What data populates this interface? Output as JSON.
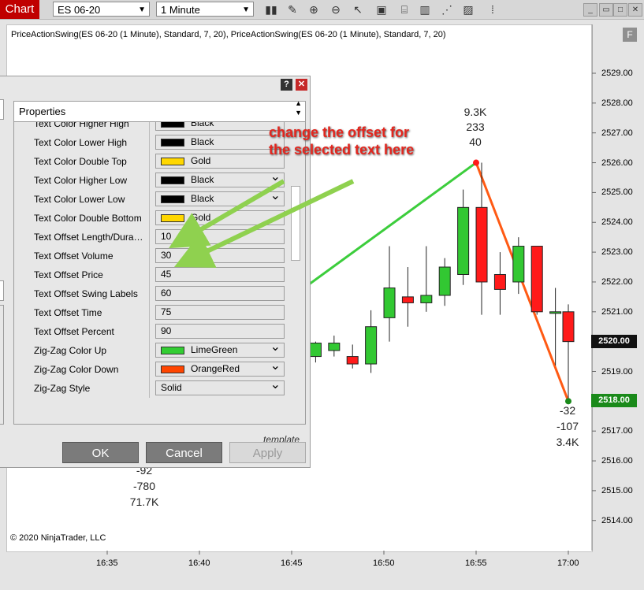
{
  "toolbar": {
    "tab_label": "Chart",
    "instrument": "ES 06-20",
    "interval": "1 Minute",
    "icons": [
      "bar-type-icon",
      "draw-pencil-icon",
      "zoom-in-icon",
      "zoom-out-icon",
      "pointer-icon",
      "data-box-icon",
      "indicators-icon",
      "strategies-icon",
      "properties-icon",
      "more-icon"
    ]
  },
  "chart": {
    "caption": "PriceActionSwing(ES 06-20 (1 Minute), Standard, 7, 20), PriceActionSwing(ES 06-20 (1 Minute), Standard, 7, 20)",
    "copyright": "© 2020 NinjaTrader, LLC",
    "f_label": "F",
    "current_price_tag": "2520.00",
    "last_swing_tag": "2518.00",
    "swing_high_label": [
      "9.3K",
      "233",
      "40"
    ],
    "swing_low_label": [
      "-32",
      "-107",
      "3.4K"
    ],
    "swing_left_label": [
      "-92",
      "-780",
      "71.7K"
    ],
    "annotation": "change the offset for the selected text here",
    "colors": {
      "up": "#32c832",
      "down": "#ff1a1a",
      "zigzag_up": "#3ccd3c",
      "zigzag_down": "#ff5a14"
    }
  },
  "chart_data": {
    "type": "candlestick",
    "y_ticks": [
      "2529.00",
      "2528.00",
      "2527.00",
      "2526.00",
      "2525.00",
      "2524.00",
      "2523.00",
      "2522.00",
      "2521.00",
      "2520.00",
      "2519.00",
      "2518.00",
      "2517.00",
      "2516.00",
      "2515.00",
      "2514.00"
    ],
    "x_ticks": [
      "16:35",
      "16:40",
      "16:45",
      "16:50",
      "16:55",
      "17:00"
    ],
    "ylim": [
      2513.6,
      2529.4
    ],
    "candles": [
      {
        "t": 46.3,
        "o": 2519.5,
        "h": 2520.0,
        "l": 2519.3,
        "c": 2519.95
      },
      {
        "t": 47.3,
        "o": 2519.7,
        "h": 2520.2,
        "l": 2519.5,
        "c": 2519.95
      },
      {
        "t": 48.3,
        "o": 2519.5,
        "h": 2519.9,
        "l": 2519.1,
        "c": 2519.25
      },
      {
        "t": 49.3,
        "o": 2519.25,
        "h": 2521.05,
        "l": 2518.95,
        "c": 2520.5
      },
      {
        "t": 50.3,
        "o": 2520.8,
        "h": 2523.2,
        "l": 2520.0,
        "c": 2521.8
      },
      {
        "t": 51.3,
        "o": 2521.5,
        "h": 2522.5,
        "l": 2520.5,
        "c": 2521.3
      },
      {
        "t": 52.3,
        "o": 2521.3,
        "h": 2523.2,
        "l": 2521.0,
        "c": 2521.55
      },
      {
        "t": 53.3,
        "o": 2521.55,
        "h": 2522.8,
        "l": 2521.2,
        "c": 2522.5
      },
      {
        "t": 54.3,
        "o": 2522.25,
        "h": 2525.1,
        "l": 2521.9,
        "c": 2524.5
      },
      {
        "t": 55.3,
        "o": 2524.5,
        "h": 2526.0,
        "l": 2520.9,
        "c": 2522.0
      },
      {
        "t": 56.3,
        "o": 2522.25,
        "h": 2523.0,
        "l": 2520.9,
        "c": 2521.75
      },
      {
        "t": 57.3,
        "o": 2522.0,
        "h": 2523.5,
        "l": 2521.6,
        "c": 2523.2
      },
      {
        "t": 58.3,
        "o": 2523.2,
        "h": 2523.2,
        "l": 2520.9,
        "c": 2521.0
      },
      {
        "t": 59.3,
        "o": 2521.0,
        "h": 2521.8,
        "l": 2519.2,
        "c": 2521.0
      },
      {
        "t": 60.0,
        "o": 2521.0,
        "h": 2521.25,
        "l": 2518.0,
        "c": 2520.0
      }
    ],
    "zigzag": [
      {
        "t": 43.9,
        "y": 2521.0,
        "dir": "up"
      },
      {
        "t": 55.0,
        "y": 2526.0,
        "dir": "up"
      },
      {
        "t": 60.0,
        "y": 2518.0,
        "dir": "down"
      }
    ]
  },
  "dialog": {
    "help_label": "?",
    "close_label": "✕",
    "header": "Properties",
    "rows": [
      {
        "label": "Text Color Higher High",
        "value": "Black",
        "color": "#000000",
        "chevron": false,
        "partial": true
      },
      {
        "label": "Text Color Lower High",
        "value": "Black",
        "color": "#000000",
        "chevron": false
      },
      {
        "label": "Text Color Double Top",
        "value": "Gold",
        "color": "#ffd700",
        "chevron": false
      },
      {
        "label": "Text Color Higher Low",
        "value": "Black",
        "color": "#000000",
        "chevron": true
      },
      {
        "label": "Text Color Lower Low",
        "value": "Black",
        "color": "#000000",
        "chevron": true
      },
      {
        "label": "Text Color Double Bottom",
        "value": "Gold",
        "color": "#ffd700",
        "chevron": false
      },
      {
        "label": "Text Offset Length/Dura…",
        "value": "10"
      },
      {
        "label": "Text Offset Volume",
        "value": "30"
      },
      {
        "label": "Text Offset Price",
        "value": "45"
      },
      {
        "label": "Text Offset Swing Labels",
        "value": "60"
      },
      {
        "label": "Text Offset Time",
        "value": "75"
      },
      {
        "label": "Text Offset Percent",
        "value": "90"
      },
      {
        "label": "Zig-Zag Color Up",
        "value": "LimeGreen",
        "color": "#32cd32",
        "chevron": true
      },
      {
        "label": "Zig-Zag Color Down",
        "value": "OrangeRed",
        "color": "#ff4500",
        "chevron": true
      },
      {
        "label": "Zig-Zag Style",
        "value": "Solid",
        "chevron": true
      }
    ],
    "template_label": "template",
    "ok_label": "OK",
    "cancel_label": "Cancel",
    "apply_label": "Apply"
  }
}
